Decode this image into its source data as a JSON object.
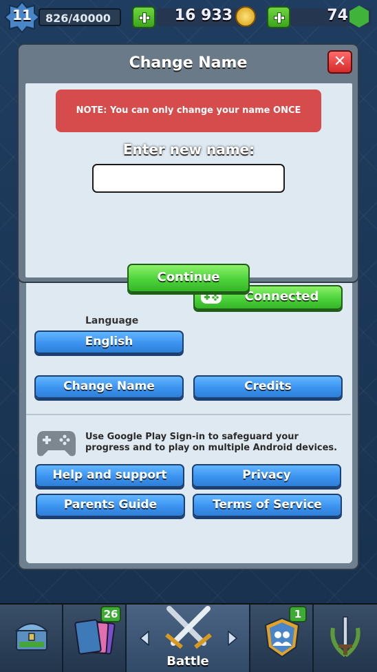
{
  "topbar": {
    "level": "11",
    "xp": "826/40000",
    "gold": "16 933",
    "gems": "74"
  },
  "dialog": {
    "title": "Change Name",
    "close_label": "✕",
    "note": "NOTE: You can only change your name ONCE",
    "enter_label": "Enter new name:",
    "name_value": "",
    "continue_label": "Continue"
  },
  "settings": {
    "connected_label": "Connected",
    "language_label": "Language",
    "language_value": "English",
    "change_name_label": "Change Name",
    "credits_label": "Credits",
    "google_play_text": "Use Google Play Sign-in to safeguard your progress and to play on multiple Android devices.",
    "help_label": "Help and support",
    "privacy_label": "Privacy",
    "parents_label": "Parents Guide",
    "terms_label": "Terms of Service"
  },
  "bottomnav": {
    "cards_badge": "26",
    "clan_badge": "1",
    "battle_label": "Battle"
  },
  "colors": {
    "green_button": "#4cd33a",
    "blue_button": "#3b93f0",
    "note_red": "#d64c4c"
  }
}
